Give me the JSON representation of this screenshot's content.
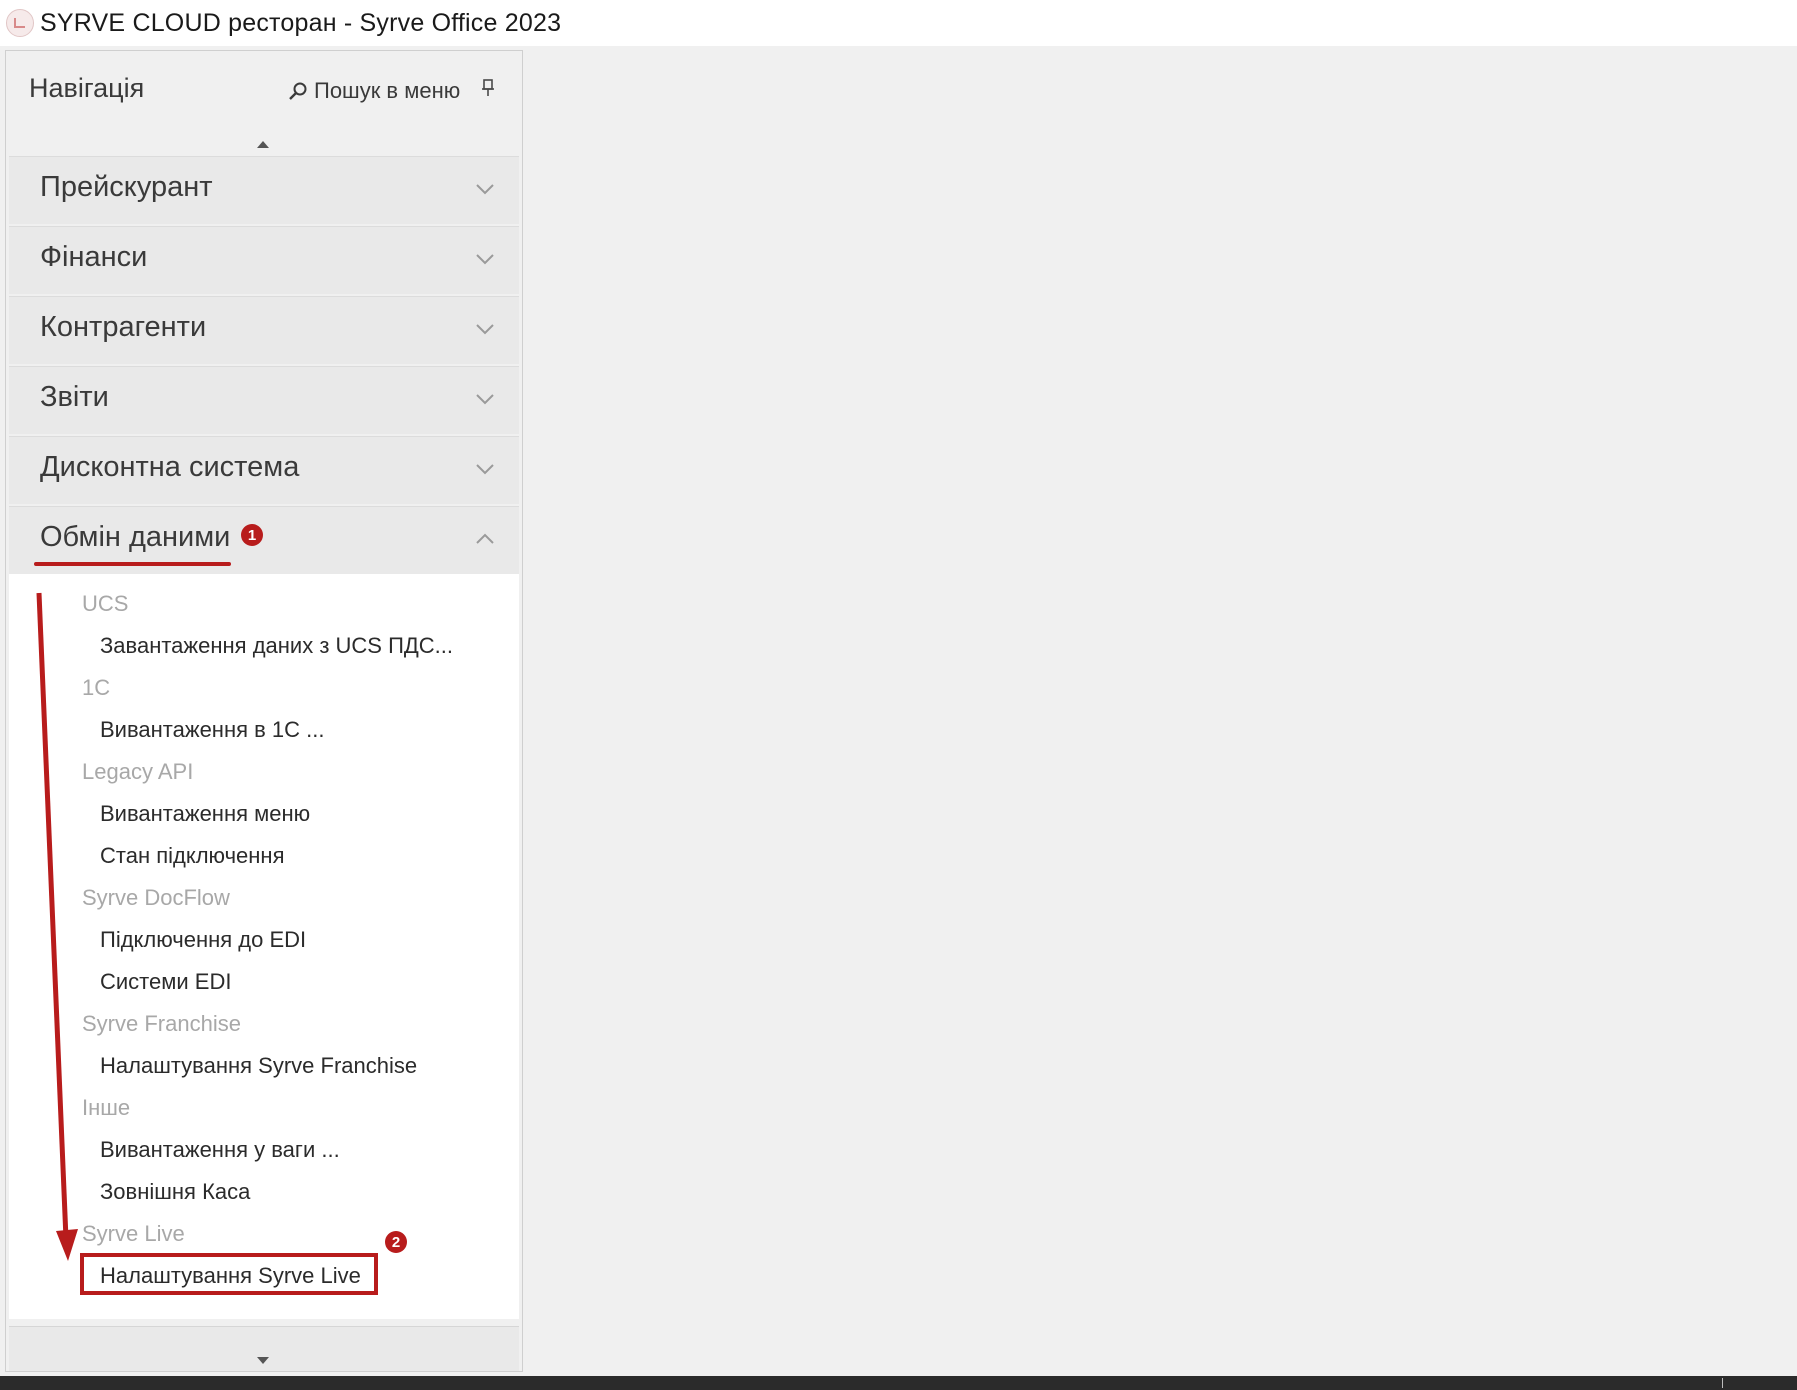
{
  "window": {
    "title": "SYRVE CLOUD ресторан - Syrve Office 2023",
    "icon": "syrve-app-icon"
  },
  "nav": {
    "title": "Навігація",
    "search_label": "Пошук в меню",
    "groups": [
      {
        "label": "Прейскурант",
        "expanded": false
      },
      {
        "label": "Фінанси",
        "expanded": false
      },
      {
        "label": "Контрагенти",
        "expanded": false
      },
      {
        "label": "Звіти",
        "expanded": false
      },
      {
        "label": "Дисконтна система",
        "expanded": false
      },
      {
        "label": "Обмін даними",
        "expanded": true
      }
    ],
    "data_exchange": {
      "sections": [
        {
          "title": "UCS",
          "items": [
            "Завантаження даних з UCS ПДС..."
          ]
        },
        {
          "title": "1С",
          "items": [
            "Вивантаження в 1С ..."
          ]
        },
        {
          "title": "Legacy API",
          "items": [
            "Вивантаження меню",
            "Стан підключення"
          ]
        },
        {
          "title": "Syrve DocFlow",
          "items": [
            "Підключення до EDI",
            "Системи EDI"
          ]
        },
        {
          "title": "Syrve Franchise",
          "items": [
            "Налаштування Syrve Franchise"
          ]
        },
        {
          "title": "Інше",
          "items": [
            "Вивантаження у ваги ...",
            "Зовнішня Каса"
          ]
        },
        {
          "title": "Syrve Live",
          "items": [
            "Налаштування Syrve Live"
          ]
        }
      ]
    }
  },
  "annotations": {
    "badge_1": "1",
    "badge_2": "2",
    "color": "#b81c1c"
  }
}
